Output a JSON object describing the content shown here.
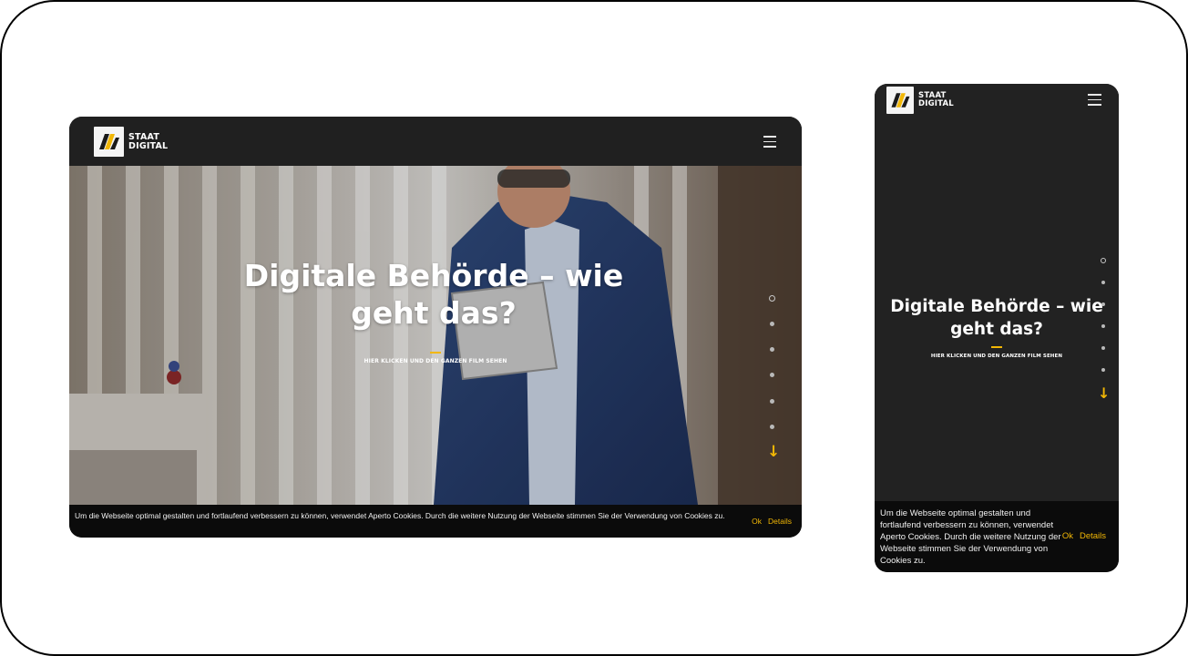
{
  "brand": {
    "line1": "STAAT",
    "line2": "DIGITAL",
    "accent_color": "#f2b705",
    "logo_icon": "staat-digital-logo-icon"
  },
  "menu": {
    "icon": "hamburger-menu-icon"
  },
  "hero": {
    "headline": "Digitale Behörde – wie geht das?",
    "cta": "Hier klicken und den ganzen Film sehen",
    "scroll_icon": "arrow-down-icon",
    "arrow_glyph": "↓",
    "section_count": 6,
    "active_section": 1
  },
  "cookie": {
    "text": "Um die Webseite optimal gestalten und fortlaufend verbessern zu können, verwendet Aperto Cookies. Durch die weitere Nutzung der Webseite stimmen Sie der Verwendung von Cookies zu.",
    "ok_label": "Ok",
    "details_label": "Details"
  },
  "colors": {
    "background": "#222222",
    "header": "#202020",
    "cookie_bar": "#0b0b0b",
    "accent": "#f2b705"
  }
}
